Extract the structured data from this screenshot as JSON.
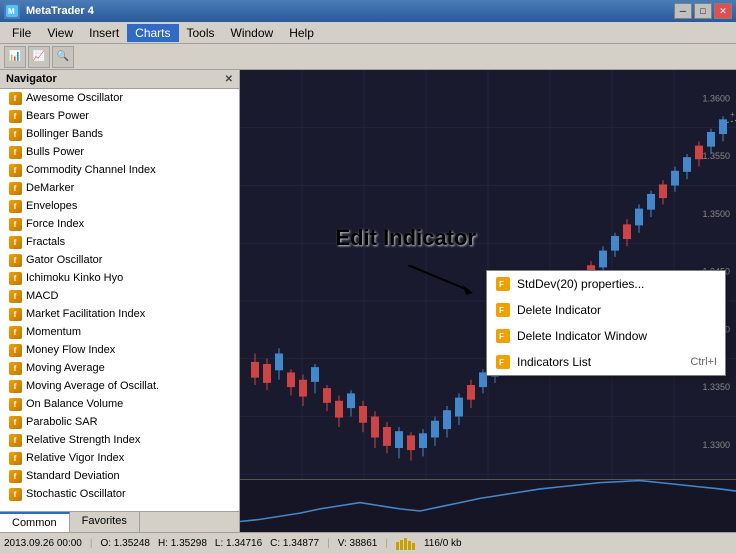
{
  "titleBar": {
    "text": "MetaTrader 4",
    "controls": [
      "minimize",
      "maximize",
      "close"
    ]
  },
  "menuBar": {
    "items": [
      "File",
      "View",
      "Insert",
      "Charts",
      "Tools",
      "Window",
      "Help"
    ]
  },
  "navigator": {
    "title": "Navigator",
    "indicators": [
      "Awesome Oscillator",
      "Bears Power",
      "Bollinger Bands",
      "Bulls Power",
      "Commodity Channel Index",
      "DeMarker",
      "Envelopes",
      "Force Index",
      "Fractals",
      "Gator Oscillator",
      "Ichimoku Kinko Hyo",
      "MACD",
      "Market Facilitation Index",
      "Momentum",
      "Money Flow Index",
      "Moving Average",
      "Moving Average of Oscillat.",
      "On Balance Volume",
      "Parabolic SAR",
      "Relative Strength Index",
      "Relative Vigor Index",
      "Standard Deviation",
      "Stochastic Oscillator"
    ],
    "tabs": [
      "Common",
      "Favorites"
    ]
  },
  "contextMenu": {
    "items": [
      {
        "label": "StdDev(20) properties...",
        "shortcut": "",
        "icon": "props"
      },
      {
        "label": "Delete Indicator",
        "shortcut": "",
        "icon": "delete"
      },
      {
        "label": "Delete Indicator Window",
        "shortcut": "",
        "icon": "delete-win"
      },
      {
        "label": "Indicators List",
        "shortcut": "Ctrl+I",
        "icon": "list"
      }
    ]
  },
  "editIndicatorLabel": "Edit Indicator",
  "statusBar": {
    "datetime": "2013.09.26 00:00",
    "open": "O: 1.35248",
    "high": "H: 1.35298",
    "low": "L: 1.34716",
    "close": "C: 1.34877",
    "volume": "V: 38861",
    "info": "116/0 kb"
  }
}
